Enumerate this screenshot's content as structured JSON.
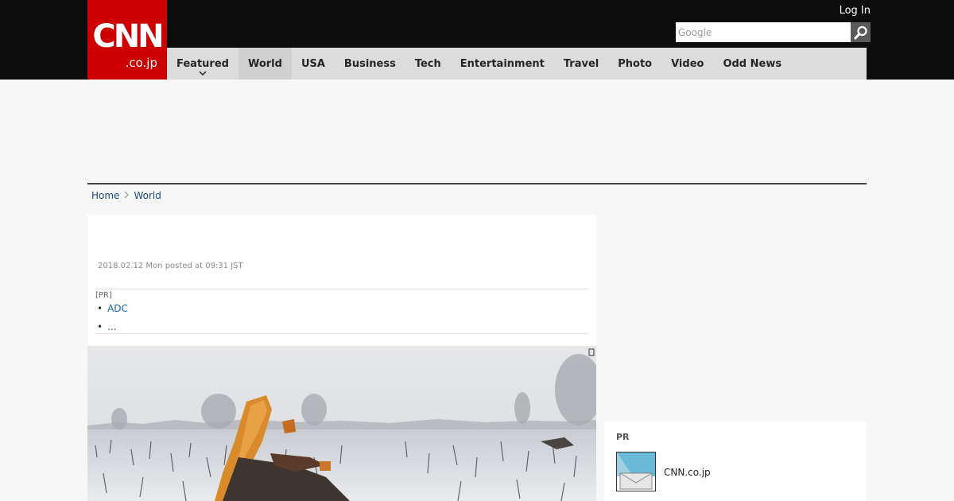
{
  "header": {
    "logo_main": "CNN",
    "logo_sub": ".co.jp",
    "login_label": "Log In",
    "search": {
      "placeholder": "Google",
      "value": ""
    }
  },
  "nav": {
    "items": [
      {
        "label": "Featured",
        "has_dropdown": true
      },
      {
        "label": "World",
        "active": true
      },
      {
        "label": "USA"
      },
      {
        "label": "Business"
      },
      {
        "label": "Tech"
      },
      {
        "label": "Entertainment"
      },
      {
        "label": "Travel"
      },
      {
        "label": "Photo"
      },
      {
        "label": "Video"
      },
      {
        "label": "Odd News"
      }
    ]
  },
  "breadcrumb": {
    "home": "Home",
    "current": "World"
  },
  "article": {
    "posted": "2018.02.12 Mon posted at 09:31 JST",
    "pr": {
      "label": "[PR]",
      "links": [
        "ADC",
        "..."
      ]
    },
    "photo": {
      "description_icon": "crash-wreckage-snow-photo"
    }
  },
  "sidebar": {
    "pr_title": "PR",
    "pr_item_name": "CNN.co.jp"
  },
  "colors": {
    "brand_red": "#cc0000",
    "topbar": "#0c0c0c",
    "nav_bg": "#dcdcdc",
    "link": "#1b4a7a"
  }
}
